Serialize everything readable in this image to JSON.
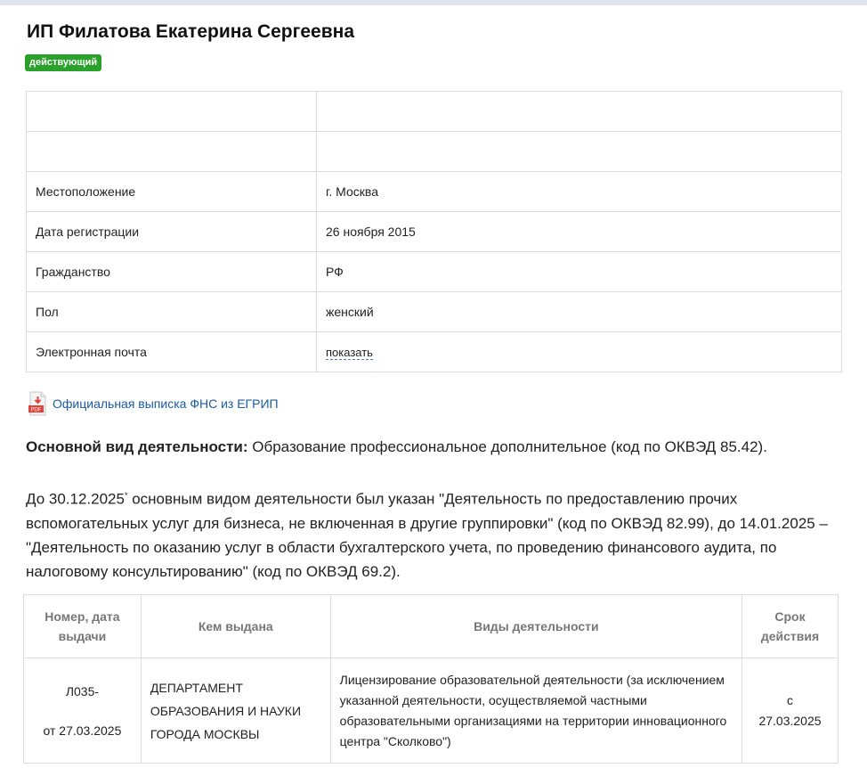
{
  "title": "ИП Филатова Екатерина Сергеевна",
  "status": "действующий",
  "info_rows": [
    {
      "label": "",
      "value": ""
    },
    {
      "label": "",
      "value": ""
    },
    {
      "label": "Местоположение",
      "value": "г. Москва"
    },
    {
      "label": "Дата регистрации",
      "value": "26 ноября 2015"
    },
    {
      "label": "Гражданство",
      "value": "РФ"
    },
    {
      "label": "Пол",
      "value": "женский"
    },
    {
      "label": "Электронная почта",
      "value": "показать"
    }
  ],
  "pdf_link": "Официальная выписка ФНС из ЕГРИП",
  "pdf_icon_text": "PDF",
  "main_activity": {
    "label": "Основной вид деятельности:",
    "text": " Образование профессиональное дополнительное (код по ОКВЭД 85.42)."
  },
  "history": {
    "prefix": "До 30.12.2025",
    "mark": "*",
    "text": " основным видом деятельности был указан \"Деятельность по предоставлению прочих вспомогательных услуг для бизнеса, не включенная в другие группировки\" (код по ОКВЭД 82.99), до 14.01.2025 – \"Деятельность по оказанию услуг в области бухгалтерского учета, по проведению финансового аудита, по налоговому консультированию\" (код по ОКВЭД 69.2)."
  },
  "license_table": {
    "headers": {
      "number": "Номер, дата выдачи",
      "issuer": "Кем выдана",
      "activities": "Виды деятельности",
      "term": "Срок действия"
    },
    "row": {
      "number": "Л035-",
      "date": "от 27.03.2025",
      "issuer": "ДЕПАРТАМЕНТ ОБРАЗОВАНИЯ И НАУКИ ГОРОДА МОСКВЫ",
      "activities": "Лицензирование образовательной деятельности (за исключением указанной деятельности, осуществляемой частными образовательными организациями на территории инновационного центра \"Сколково\")",
      "term_prefix": "с",
      "term_date": "27.03.2025"
    }
  },
  "colors": {
    "status_green": "#2aa12a",
    "link_blue": "#1b5ba0",
    "pdf_red": "#e0443a"
  },
  "icons": [
    "pdf-icon"
  ]
}
